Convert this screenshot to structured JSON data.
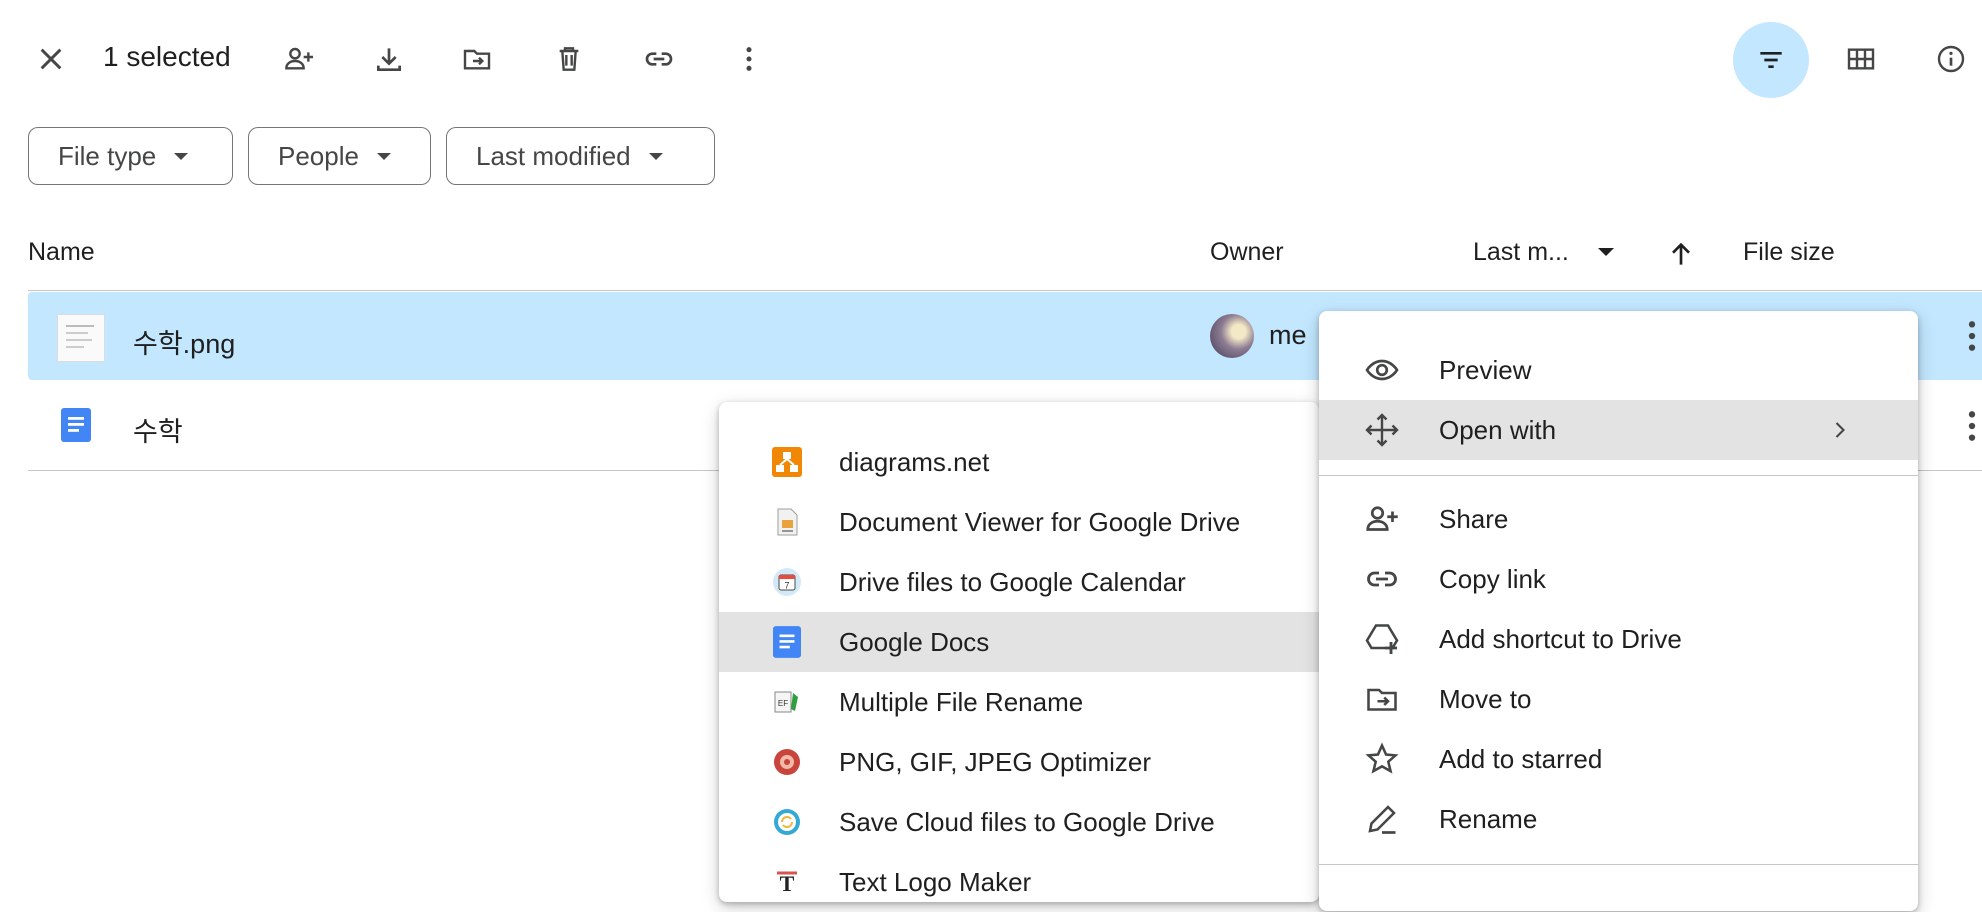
{
  "toolbar": {
    "selected_label": "1 selected",
    "icons": [
      "close-icon",
      "add-person-icon",
      "download-icon",
      "move-to-folder-icon",
      "delete-icon",
      "link-icon",
      "more-vert-icon",
      "filter-icon",
      "grid-view-icon",
      "info-icon"
    ]
  },
  "filters": [
    {
      "label": "File type"
    },
    {
      "label": "People"
    },
    {
      "label": "Last modified"
    }
  ],
  "columns": {
    "name": "Name",
    "owner": "Owner",
    "last_modified": "Last m...",
    "file_size": "File size"
  },
  "files": [
    {
      "name": "수학.png",
      "owner": "me",
      "selected": true,
      "icon": "image-thumbnail"
    },
    {
      "name": "수학",
      "owner": "",
      "selected": false,
      "icon": "google-docs-icon"
    }
  ],
  "context_menu": {
    "items": [
      {
        "label": "Preview",
        "icon": "eye-icon"
      },
      {
        "label": "Open with",
        "icon": "open-with-icon",
        "highlighted": true,
        "submenu": true
      },
      {
        "label": "Share",
        "icon": "add-person-icon"
      },
      {
        "label": "Copy link",
        "icon": "link-icon"
      },
      {
        "label": "Add shortcut to Drive",
        "icon": "add-shortcut-icon"
      },
      {
        "label": "Move to",
        "icon": "move-to-folder-icon"
      },
      {
        "label": "Add to starred",
        "icon": "star-icon"
      },
      {
        "label": "Rename",
        "icon": "rename-pencil-icon"
      }
    ]
  },
  "open_with_menu": {
    "items": [
      {
        "label": "diagrams.net",
        "icon": "diagrams-net-icon"
      },
      {
        "label": "Document Viewer for Google Drive",
        "icon": "document-viewer-icon"
      },
      {
        "label": "Drive files to Google Calendar",
        "icon": "calendar-icon"
      },
      {
        "label": "Google Docs",
        "icon": "google-docs-icon",
        "highlighted": true
      },
      {
        "label": "Multiple File Rename",
        "icon": "file-rename-icon"
      },
      {
        "label": "PNG, GIF, JPEG Optimizer",
        "icon": "optimizer-icon"
      },
      {
        "label": "Save Cloud files to Google Drive",
        "icon": "save-cloud-icon"
      },
      {
        "label": "Text Logo Maker",
        "icon": "text-logo-icon"
      }
    ]
  },
  "colors": {
    "selection": "#c2e7ff",
    "active_filter_button": "#c2e7ff",
    "menu_highlight": "#e3e3e3",
    "docs_blue": "#4285f4",
    "diagrams_orange": "#f08705"
  }
}
